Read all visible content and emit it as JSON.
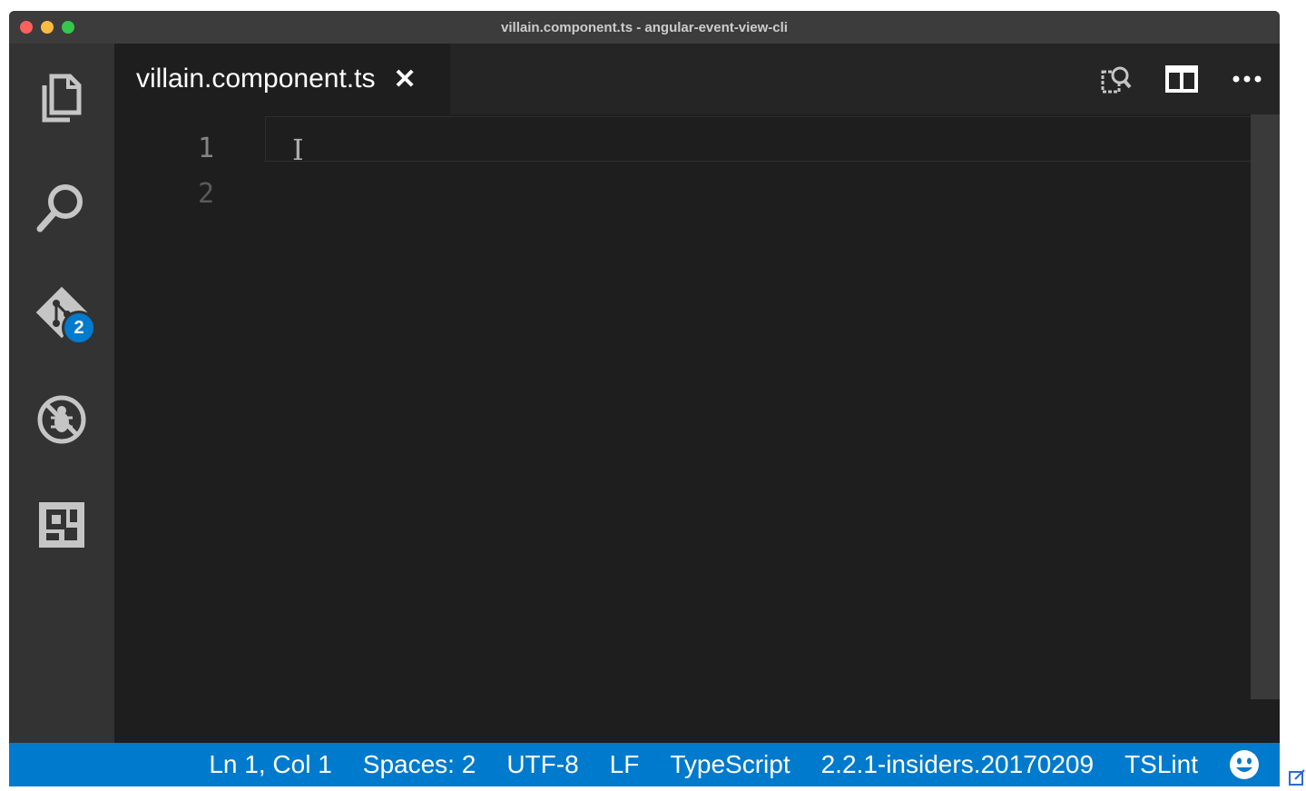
{
  "window": {
    "title": "villain.component.ts - angular-event-view-cli"
  },
  "activitybar": {
    "items": [
      {
        "name": "explorer-icon"
      },
      {
        "name": "search-icon"
      },
      {
        "name": "source-control-icon",
        "badge": "2"
      },
      {
        "name": "debug-icon"
      },
      {
        "name": "extensions-icon"
      }
    ]
  },
  "tabs": [
    {
      "label": "villain.component.ts",
      "close": "✕"
    }
  ],
  "editor_actions": [
    "open-preview-icon",
    "split-editor-icon",
    "more-actions-icon"
  ],
  "editor": {
    "line_numbers": [
      "1",
      "2"
    ]
  },
  "statusbar": {
    "position": "Ln 1, Col 1",
    "indentation": "Spaces: 2",
    "encoding": "UTF-8",
    "eol": "LF",
    "language": "TypeScript",
    "ts_version": "2.2.1-insiders.20170209",
    "linter": "TSLint",
    "feedback_icon": "smiley-icon"
  },
  "colors": {
    "statusbar": "#007acc",
    "badge": "#007acc",
    "editor_bg": "#1e1e1e",
    "activitybar_bg": "#333333"
  }
}
